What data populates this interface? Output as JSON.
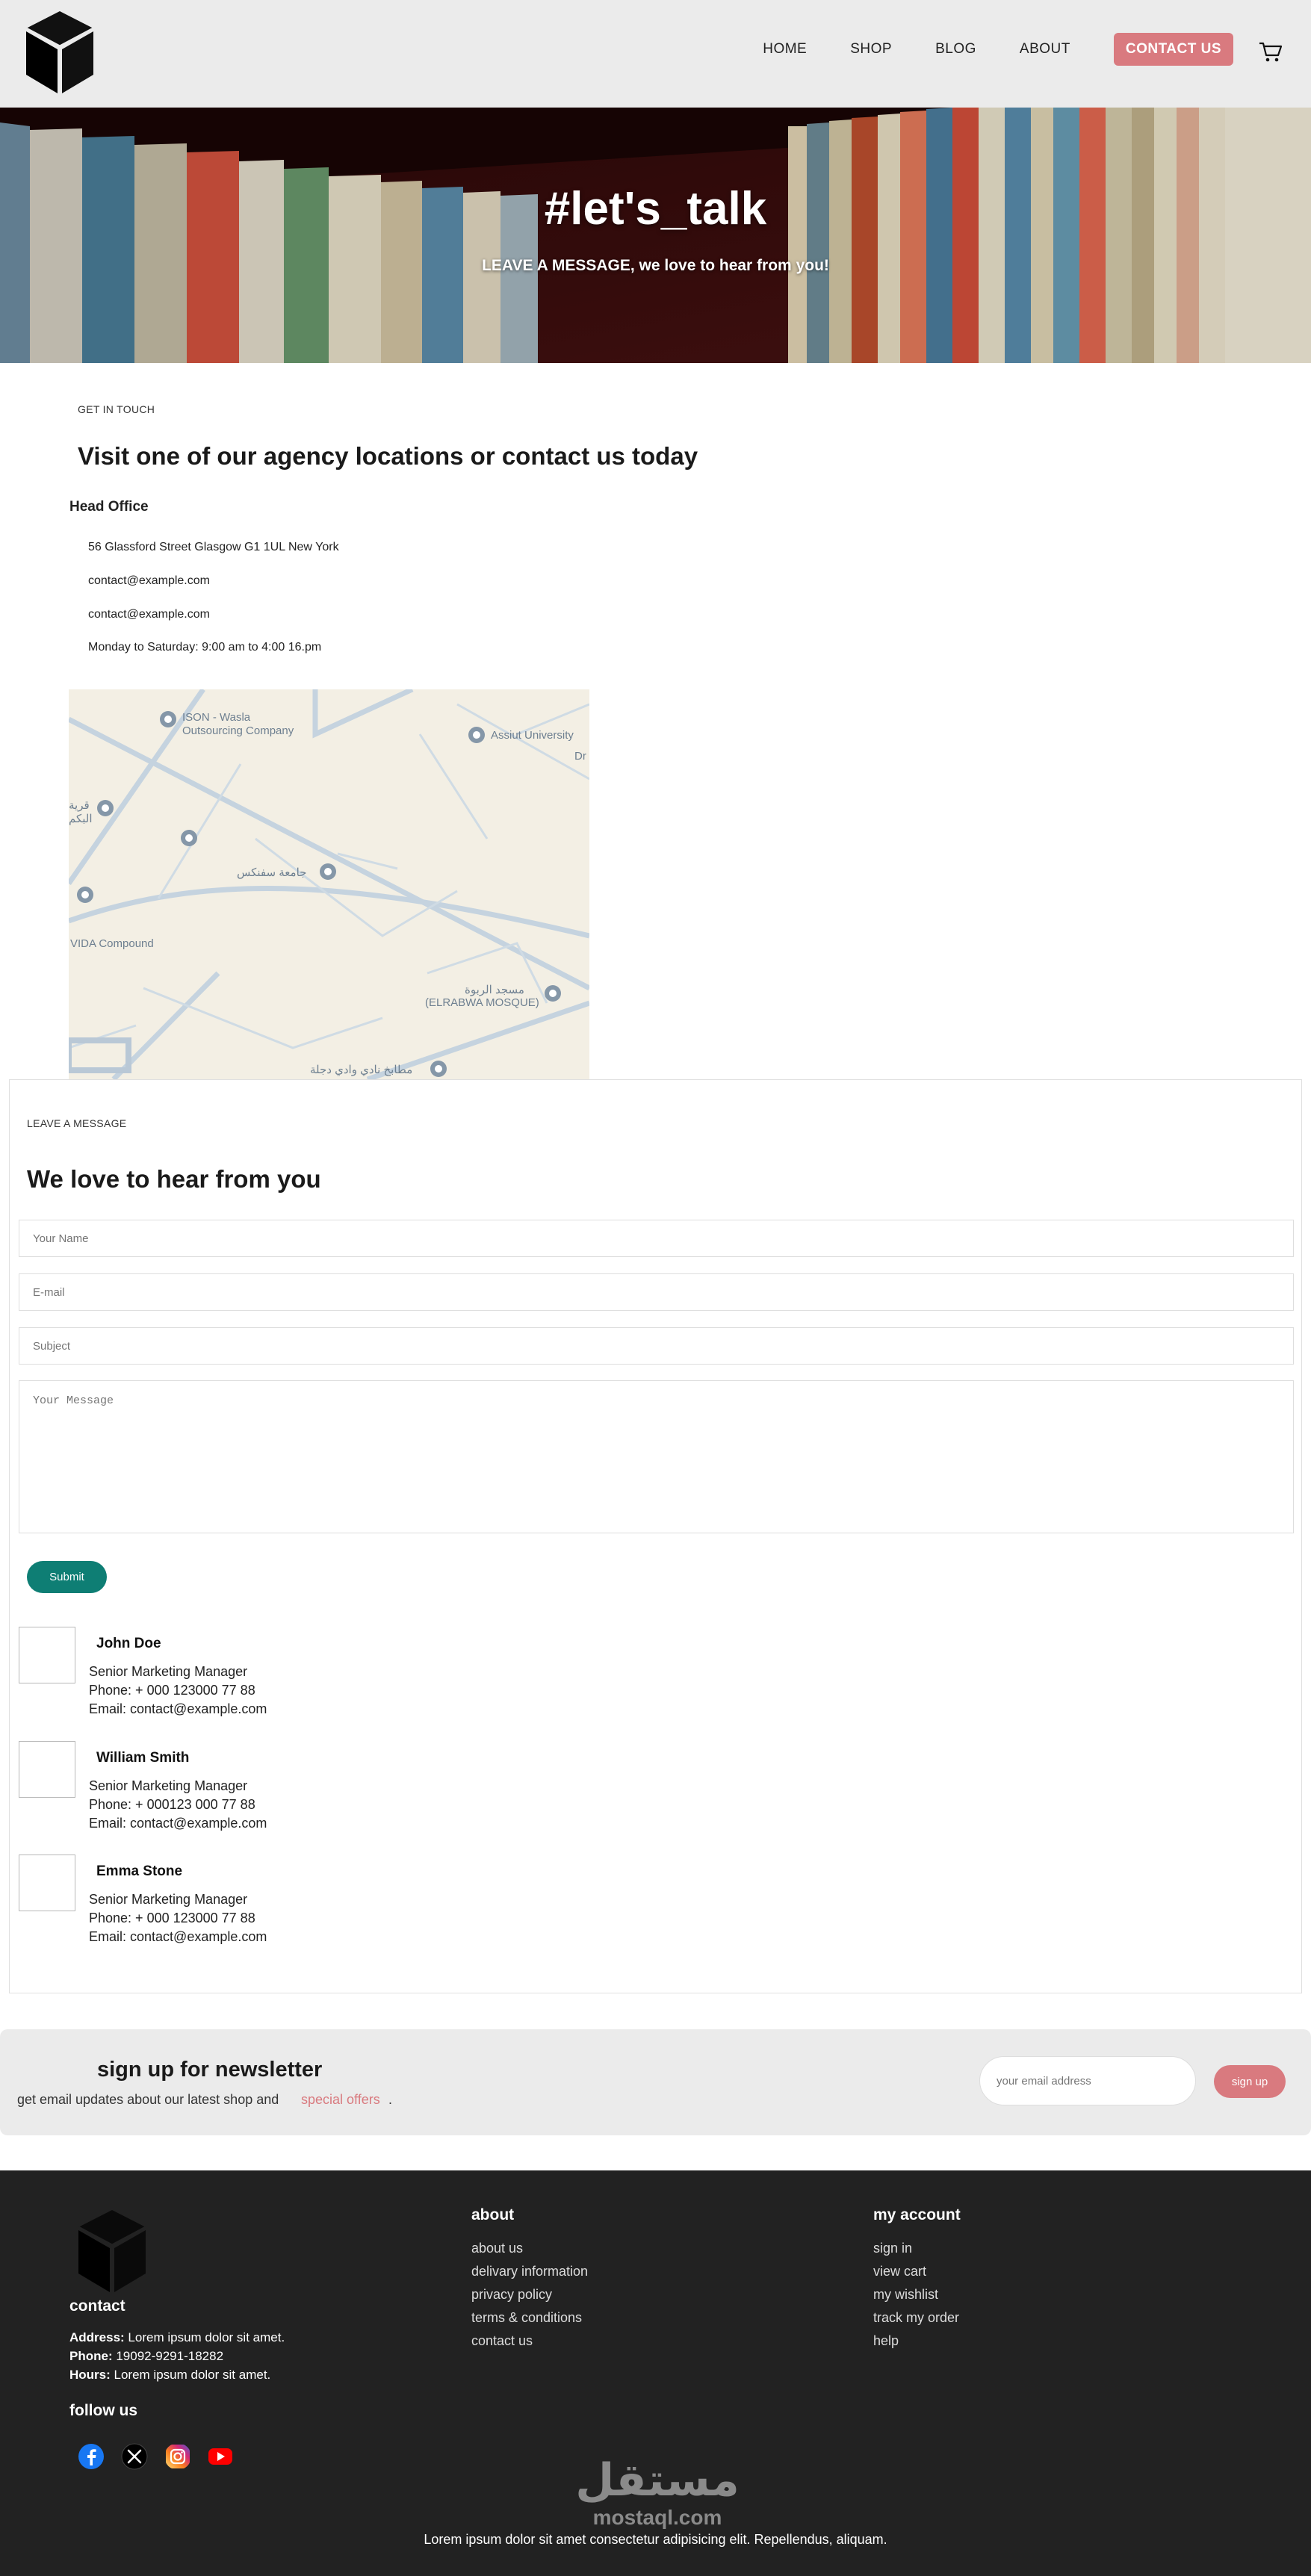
{
  "header": {
    "nav": [
      "HOME",
      "SHOP",
      "BLOG",
      "ABOUT",
      "CONTACT US"
    ],
    "active_nav": "CONTACT US"
  },
  "hero": {
    "title": "#let's_talk",
    "subtitle": "LEAVE A MESSAGE, we love to hear from you!"
  },
  "contact_info": {
    "eyebrow": "GET IN TOUCH",
    "heading": "Visit one of our agency locations or contact us today",
    "office_title": "Head Office",
    "lines": [
      "56 Glassford Street Glasgow G1 1UL New York",
      "contact@example.com",
      "contact@example.com",
      "Monday to Saturday: 9:00 am to 4:00 16.pm"
    ]
  },
  "map": {
    "labels": [
      "ISON - Wasla",
      "Outsourcing Company",
      "Assiut University",
      "Dr",
      "قرية",
      "البكم",
      "جامعة سفنكس",
      "VIDA Compound",
      "مسجد الربوة",
      "(ELRABWA MOSQUE)",
      "مطابخ نادي وادي دجلة"
    ]
  },
  "form": {
    "eyebrow": "LEAVE A MESSAGE",
    "heading": "We love to hear from you",
    "name_placeholder": "Your Name",
    "email_placeholder": "E-mail",
    "subject_placeholder": "Subject",
    "message_placeholder": "Your Message",
    "submit_label": "Submit"
  },
  "people": [
    {
      "name": "John Doe",
      "role": "Senior Marketing Manager",
      "phone": "Phone: + 000 123000 77 88",
      "email": "Email: contact@example.com"
    },
    {
      "name": "William Smith",
      "role": "Senior Marketing Manager",
      "phone": "Phone: + 000123 000 77 88",
      "email": "Email: contact@example.com"
    },
    {
      "name": "Emma Stone",
      "role": "Senior Marketing Manager",
      "phone": "Phone: + 000 123000 77 88",
      "email": "Email: contact@example.com"
    }
  ],
  "newsletter": {
    "title": "sign up for newsletter",
    "text": "get email updates about our latest shop and",
    "offer": "special offers",
    "dot": ".",
    "placeholder": "your email address",
    "button": "sign up"
  },
  "footer": {
    "contact_heading": "contact",
    "address_label": "Address:",
    "address_value": "Lorem ipsum dolor sit amet.",
    "phone_label": "Phone:",
    "phone_value": "19092-9291-18282",
    "hours_label": "Hours:",
    "hours_value": "Lorem ipsum dolor sit amet.",
    "follow_heading": "follow us",
    "about_heading": "about",
    "about_links": [
      "about us",
      "delivary information",
      "privacy policy",
      "terms & conditions",
      "contact us"
    ],
    "account_heading": "my account",
    "account_links": [
      "sign in",
      "view cart",
      "my wishlist",
      "track my order",
      "help"
    ],
    "watermark_ar": "مستقل",
    "watermark_en": "mostaql.com",
    "bottom_text": "Lorem ipsum dolor sit amet consectetur adipisicing elit. Repellendus, aliquam."
  },
  "colors": {
    "accent": "#d97a7f",
    "teal": "#0e7e74",
    "header_bg": "#ebebeb",
    "footer_bg": "#222222"
  },
  "icons": [
    "cube-logo-icon",
    "cart-icon",
    "map-pin-icon",
    "facebook-icon",
    "x-icon",
    "instagram-icon",
    "youtube-icon"
  ]
}
